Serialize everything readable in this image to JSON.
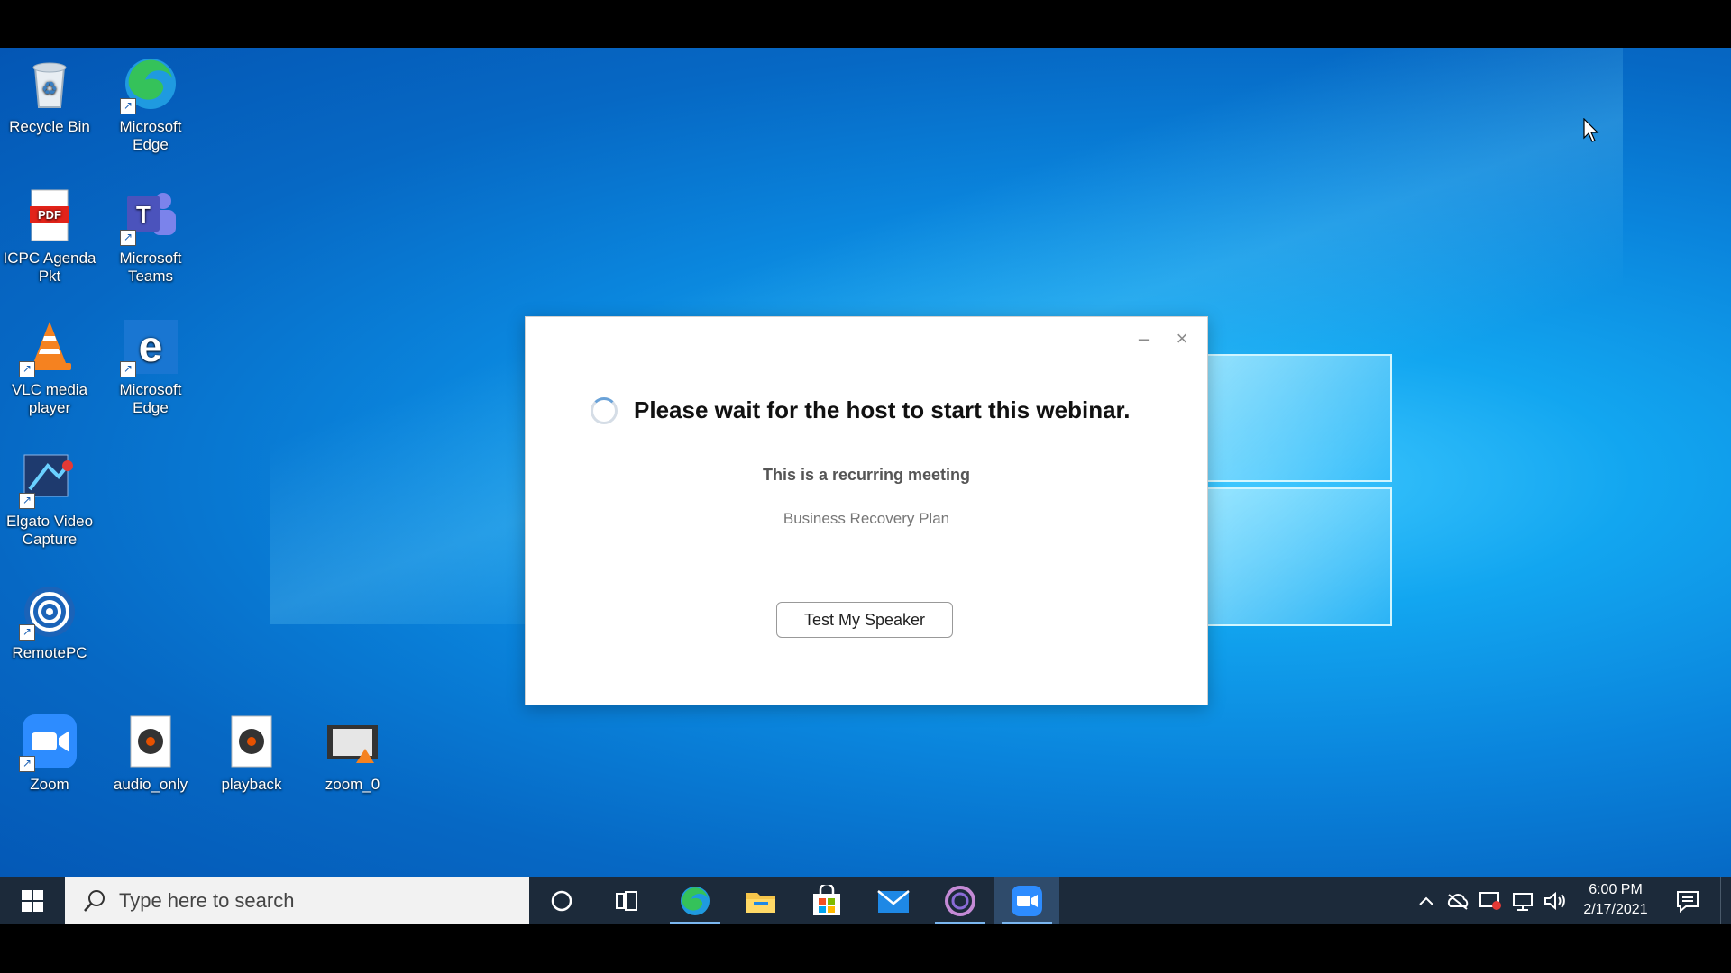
{
  "desktop": {
    "icons": [
      {
        "label": "Recycle Bin",
        "icon": "recycle-bin-icon"
      },
      {
        "label": "Microsoft Edge",
        "icon": "edge-icon"
      },
      {
        "label": "ICPC Agenda Pkt",
        "icon": "pdf-file-icon"
      },
      {
        "label": "Microsoft Teams",
        "icon": "teams-icon"
      },
      {
        "label": "VLC media player",
        "icon": "vlc-icon"
      },
      {
        "label": "Microsoft Edge",
        "icon": "edge-legacy-icon"
      },
      {
        "label": "Elgato Video Capture",
        "icon": "elgato-icon"
      },
      {
        "label": "RemotePC",
        "icon": "remotepc-icon"
      },
      {
        "label": "Zoom",
        "icon": "zoom-icon"
      },
      {
        "label": "audio_only",
        "icon": "media-file-icon"
      },
      {
        "label": "playback",
        "icon": "media-file-icon"
      },
      {
        "label": "zoom_0",
        "icon": "video-file-icon"
      }
    ]
  },
  "dialog": {
    "minimize": "–",
    "close": "×",
    "wait_message": "Please wait for the host to start this webinar.",
    "recurring_label": "This is a recurring meeting",
    "meeting_name": "Business Recovery Plan",
    "test_speaker_label": "Test My Speaker"
  },
  "taskbar": {
    "search_placeholder": "Type here to search",
    "apps": [
      "cortana-icon",
      "task-view-icon",
      "edge-icon",
      "file-explorer-icon",
      "store-icon",
      "mail-icon",
      "app-icon",
      "zoom-icon"
    ],
    "clock": {
      "time": "6:00 PM",
      "date": "2/17/2021"
    }
  },
  "colors": {
    "accent": "#2d8cff",
    "taskbar": "#1c2a3a"
  }
}
